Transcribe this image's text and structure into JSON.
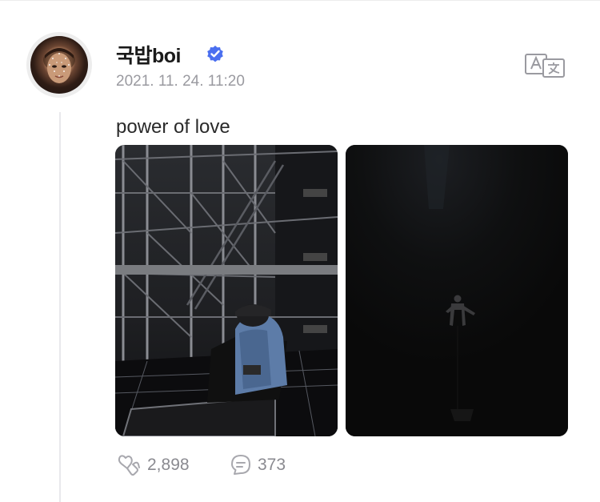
{
  "post": {
    "author": {
      "name": "국밥boi",
      "verified": true
    },
    "timestamp": "2021. 11. 24. 11:20",
    "text": "power of love",
    "photos": [
      {
        "icon": "backstage-scaffolding-photo"
      },
      {
        "icon": "dark-stage-silhouette-photo"
      }
    ],
    "stats": {
      "likes": "2,898",
      "comments": "373"
    }
  },
  "colors": {
    "verified_badge": "#4a6ff0",
    "muted_text": "#9a9aa0",
    "icon_gray": "#a8a8ae",
    "thread_line": "#e9e9ec"
  }
}
